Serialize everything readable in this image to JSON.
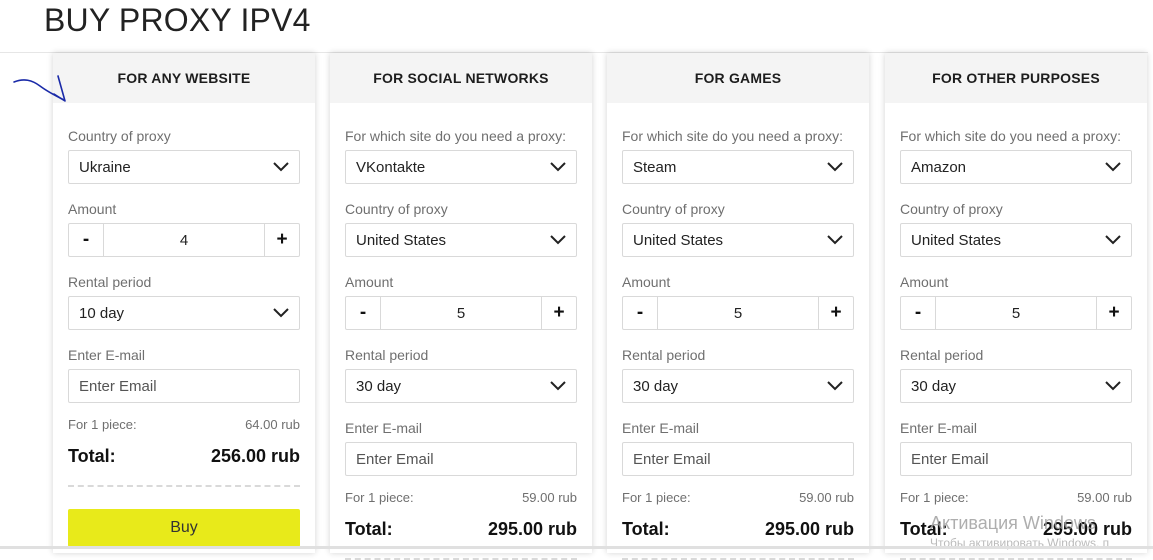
{
  "page": {
    "title": "BUY PROXY IPV4"
  },
  "cards": [
    {
      "header": "FOR ANY WEBSITE",
      "country_label": "Country of proxy",
      "country_value": "Ukraine",
      "amount_label": "Amount",
      "amount_value": "4",
      "minus": "-",
      "plus": "+",
      "period_label": "Rental period",
      "period_value": "10 day",
      "email_label": "Enter E-mail",
      "email_placeholder": "Enter Email",
      "piece_label": "For 1 piece:",
      "piece_price": "64.00 rub",
      "total_label": "Total:",
      "total_value": "256.00 rub",
      "buy_label": "Buy"
    },
    {
      "header": "FOR SOCIAL NETWORKS",
      "site_label": "For which site do you need a proxy:",
      "site_value": "VKontakte",
      "country_label": "Country of proxy",
      "country_value": "United States",
      "amount_label": "Amount",
      "amount_value": "5",
      "minus": "-",
      "plus": "+",
      "period_label": "Rental period",
      "period_value": "30 day",
      "email_label": "Enter E-mail",
      "email_placeholder": "Enter Email",
      "piece_label": "For 1 piece:",
      "piece_price": "59.00 rub",
      "total_label": "Total:",
      "total_value": "295.00 rub"
    },
    {
      "header": "FOR GAMES",
      "site_label": "For which site do you need a proxy:",
      "site_value": "Steam",
      "country_label": "Country of proxy",
      "country_value": "United States",
      "amount_label": "Amount",
      "amount_value": "5",
      "minus": "-",
      "plus": "+",
      "period_label": "Rental period",
      "period_value": "30 day",
      "email_label": "Enter E-mail",
      "email_placeholder": "Enter Email",
      "piece_label": "For 1 piece:",
      "piece_price": "59.00 rub",
      "total_label": "Total:",
      "total_value": "295.00 rub"
    },
    {
      "header": "FOR OTHER PURPOSES",
      "site_label": "For which site do you need a proxy:",
      "site_value": "Amazon",
      "country_label": "Country of proxy",
      "country_value": "United States",
      "amount_label": "Amount",
      "amount_value": "5",
      "minus": "-",
      "plus": "+",
      "period_label": "Rental period",
      "period_value": "30 day",
      "email_label": "Enter E-mail",
      "email_placeholder": "Enter Email",
      "piece_label": "For 1 piece:",
      "piece_price": "59.00 rub",
      "total_label": "Total:",
      "total_value": "295.00 rub"
    }
  ],
  "watermark": {
    "title": "Активация Windows",
    "subtitle": "Чтобы активировать Windows, п"
  },
  "colors": {
    "buy_button": "#e8ea1a",
    "header_bg": "#f4f4f4",
    "annotation_arrow": "#1a2aa8"
  },
  "icons": {
    "select_arrow": "chevron-down-icon",
    "annotation": "hand-drawn-arrow-icon"
  }
}
